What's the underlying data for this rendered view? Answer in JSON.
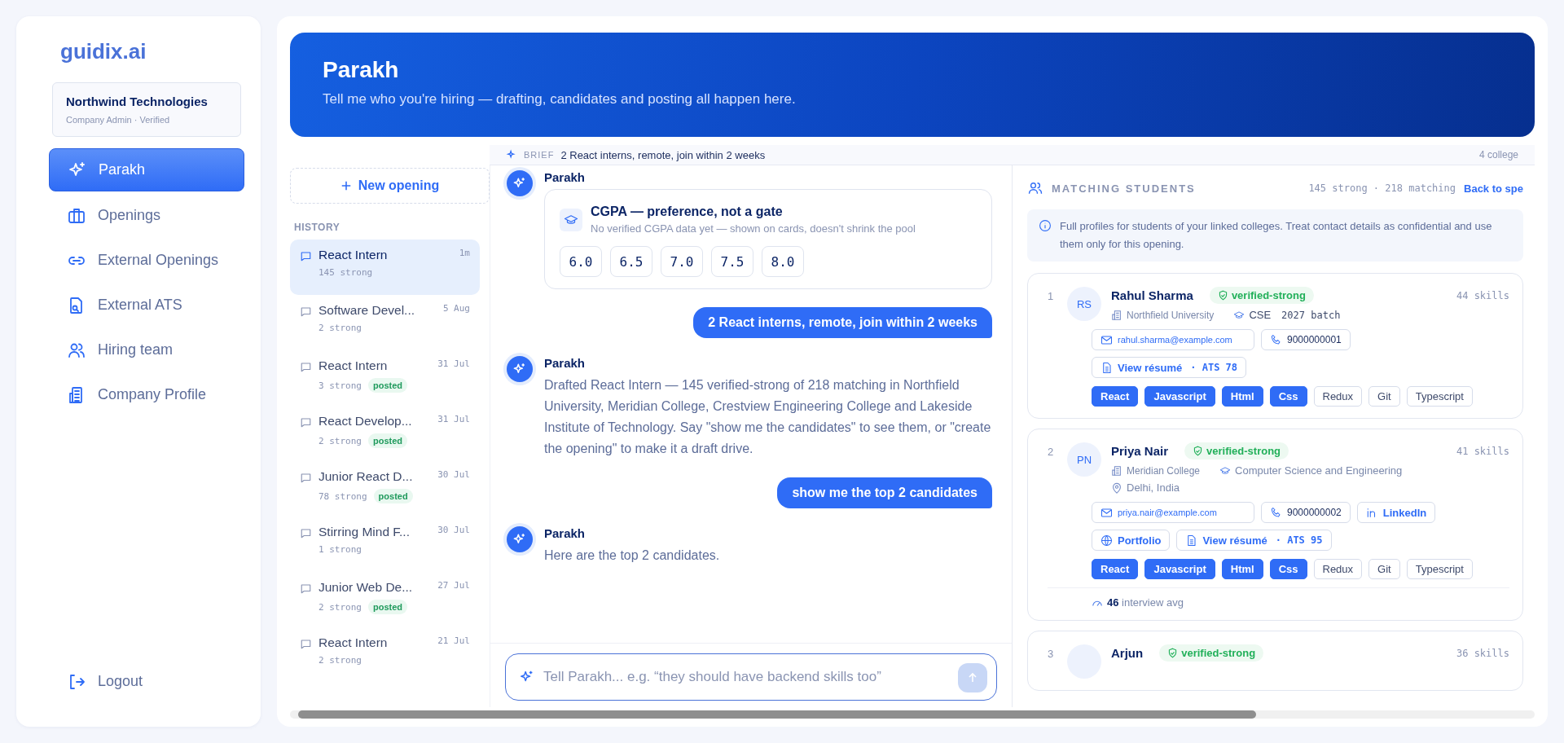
{
  "sidebar": {
    "logo": "guidix.ai",
    "company": {
      "name": "Northwind Technologies",
      "subtitle": "Company Admin · Verified"
    },
    "nav": [
      {
        "label": "Parakh",
        "kind": "sparkle",
        "selected": true
      },
      {
        "label": "Openings",
        "kind": "briefcase",
        "selected": false
      },
      {
        "label": "External Openings",
        "kind": "link",
        "selected": false
      },
      {
        "label": "External ATS",
        "kind": "file",
        "selected": false
      },
      {
        "label": "Hiring team",
        "kind": "people",
        "selected": false
      },
      {
        "label": "Company Profile",
        "kind": "building",
        "selected": false
      }
    ],
    "logout": "Logout"
  },
  "header": {
    "title": "Parakh",
    "subtitle": "Tell me who you're hiring — drafting, candidates and posting all happen here."
  },
  "history": {
    "new_button": "New opening",
    "heading": "HISTORY",
    "items": [
      {
        "title": "React Intern",
        "time": "1m",
        "count": "145 strong",
        "posted": false,
        "selected": true
      },
      {
        "title": "Software Devel...",
        "time": "5 Aug",
        "count": "2 strong",
        "posted": false,
        "selected": false
      },
      {
        "title": "React Intern",
        "time": "31 Jul",
        "count": "3 strong",
        "posted": true,
        "badge": "posted",
        "selected": false
      },
      {
        "title": "React Develop...",
        "time": "31 Jul",
        "count": "2 strong",
        "posted": true,
        "badge": "posted",
        "selected": false
      },
      {
        "title": "Junior React D...",
        "time": "30 Jul",
        "count": "78 strong",
        "posted": true,
        "badge": "posted",
        "selected": false
      },
      {
        "title": "Stirring Mind F...",
        "time": "30 Jul",
        "count": "1 strong",
        "posted": false,
        "selected": false
      },
      {
        "title": "Junior Web De...",
        "time": "27 Jul",
        "count": "2 strong",
        "posted": true,
        "badge": "posted",
        "selected": false
      },
      {
        "title": "React Intern",
        "time": "21 Jul",
        "count": "2 strong",
        "posted": false,
        "selected": false
      }
    ]
  },
  "brief": {
    "label": "BRIEF",
    "text": "2 React interns, remote, join within 2 weeks",
    "colleges": "4 college"
  },
  "chat": {
    "messages": [
      {
        "kind": "cgpa",
        "author": "Parakh",
        "title": "CGPA — preference, not a gate",
        "subtitle": "No verified CGPA data yet — shown on cards, doesn't shrink the pool",
        "options": [
          "6.0",
          "6.5",
          "7.0",
          "7.5",
          "8.0"
        ]
      },
      {
        "kind": "user",
        "text": "2 React interns, remote, join within 2 weeks"
      },
      {
        "kind": "bot",
        "author": "Parakh",
        "text": "Drafted React Intern — 145 verified-strong of 218 matching in Northfield University, Meridian College, Crestview Engineering College and Lakeside Institute of Technology. Say \"show me the candidates\" to see them, or \"create the opening\" to make it a draft drive."
      },
      {
        "kind": "user",
        "text": "show me the top 2 candidates"
      },
      {
        "kind": "bot",
        "author": "Parakh",
        "text": "Here are the top 2 candidates."
      }
    ],
    "input": {
      "placeholder": "Tell Parakh... e.g. “they should have backend skills too”"
    }
  },
  "students": {
    "heading": "MATCHING STUDENTS",
    "summary": "145 strong · 218 matching",
    "back_link": "Back to spe",
    "notice": "Full profiles for students of your linked colleges. Treat contact details as confidential and use them only for this opening.",
    "cards": [
      {
        "rank": "1",
        "initials": "RS",
        "name": "Rahul Sharma",
        "badge": "verified-strong",
        "skills_count": "44 skills",
        "college": "Northfield University",
        "branch": "CSE",
        "batch": "2027 batch",
        "contacts": [
          {
            "kind": "email",
            "text": "rahul.sharma@example.com"
          },
          {
            "kind": "phone",
            "text": "9000000001"
          },
          {
            "kind": "resume",
            "text": "View résumé",
            "score": "· ATS 78"
          }
        ],
        "skills": [
          {
            "name": "React",
            "matched": true
          },
          {
            "name": "Javascript",
            "matched": true
          },
          {
            "name": "Html",
            "matched": true
          },
          {
            "name": "Css",
            "matched": true
          },
          {
            "name": "Redux",
            "matched": false
          },
          {
            "name": "Git",
            "matched": false
          },
          {
            "name": "Typescript",
            "matched": false
          }
        ]
      },
      {
        "rank": "2",
        "initials": "PN",
        "name": "Priya Nair",
        "badge": "verified-strong",
        "skills_count": "41 skills",
        "college": "Meridian College",
        "branch": "Computer Science and Engineering",
        "location": "Delhi, India",
        "contacts": [
          {
            "kind": "email",
            "text": "priya.nair@example.com"
          },
          {
            "kind": "phone",
            "text": "9000000002"
          },
          {
            "kind": "linkedin",
            "text": "LinkedIn"
          },
          {
            "kind": "portfolio",
            "text": "Portfolio"
          },
          {
            "kind": "resume",
            "text": "View résumé",
            "score": "· ATS 95"
          }
        ],
        "skills": [
          {
            "name": "React",
            "matched": true
          },
          {
            "name": "Javascript",
            "matched": true
          },
          {
            "name": "Html",
            "matched": true
          },
          {
            "name": "Css",
            "matched": true
          },
          {
            "name": "Redux",
            "matched": false
          },
          {
            "name": "Git",
            "matched": false
          },
          {
            "name": "Typescript",
            "matched": false
          }
        ],
        "interview": {
          "score": "46",
          "label": "interview avg"
        }
      },
      {
        "rank": "3",
        "name": "Arjun",
        "badge": "verified-strong",
        "skills_count": "36 skills"
      }
    ]
  }
}
